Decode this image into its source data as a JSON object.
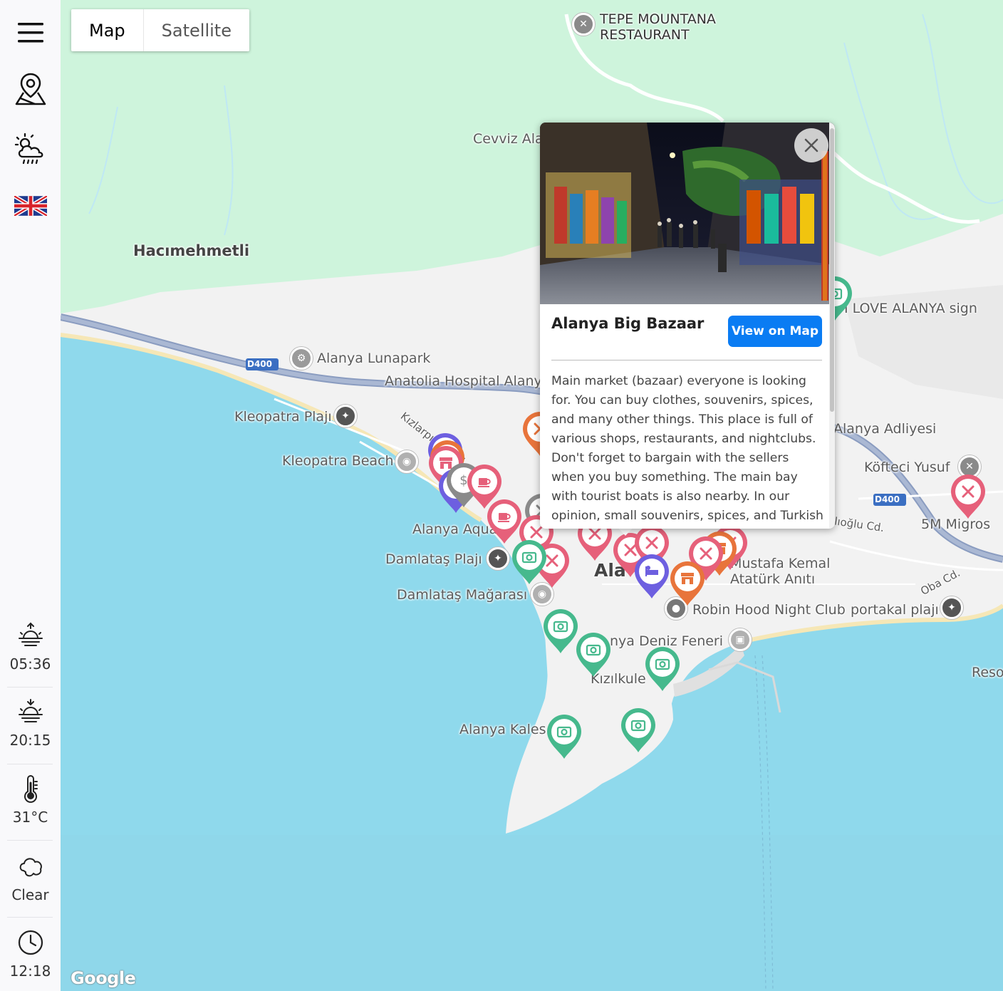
{
  "sidebar": {
    "menu_icon": "hamburger-menu-icon",
    "map_icon": "map-pin-icon",
    "weather_icon": "weather-cloud-sun-rain-icon",
    "language_icon": "uk-flag-icon",
    "sunrise": "05:36",
    "sunset": "20:15",
    "temperature": "31°C",
    "condition": "Clear",
    "time": "12:18"
  },
  "map_type": {
    "map_label": "Map",
    "satellite_label": "Satellite",
    "selected": "Map"
  },
  "map_labels": {
    "tepe_line1": "TEPE MOUNTANA",
    "tepe_line2": "RESTAURANT",
    "cevviz": "Cevviz Ala",
    "hacimehmetli": "Hacımehmetli",
    "lunapark": "Alanya Lunapark",
    "hospital": "Anatolia Hospital Alany",
    "d400_left": "D400",
    "d400_right": "D400",
    "kleopatra_plaji": "Kleopatra Plajı",
    "kleopatra_beach": "Kleopatra Beach",
    "kizlarpinari": "Kızlarpınarı Cd.",
    "aqua": "Alanya Aqua",
    "damlatas_plaji": "Damlataş Plajı",
    "damlatas_magarasi": "Damlataş Mağarası",
    "alanya_center": "Ala",
    "love_sign": "I LOVE ALANYA sign",
    "adliyesi": "Alanya Adliyesi",
    "kofteci": "Köfteci Yusuf",
    "migros": "5M Migros",
    "hoglu": "ılıoğlu Cd.",
    "oba": "Oba Cd.",
    "mustafa_line1": "Mustafa Kemal",
    "mustafa_line2": "Atatürk Anıtı",
    "robin_hood": "Robin Hood Night Club",
    "portakal": "portakal plajı",
    "deniz_feneri": "nya Deniz Feneri",
    "kizilkule": "Kızılkule",
    "kalesi": "Alanya Kales",
    "reso": "Reso",
    "google": "Google"
  },
  "popup": {
    "title": "Alanya Big Bazaar",
    "button_label": "View on Map",
    "description": "Main market (bazaar) everyone is looking for. You can buy clothes, souvenirs, spices, and many other things. This place is full of various shops, restaurants, and nightclubs. Don't forget to bargain with the sellers when you buy something. The main bay with tourist boats is also nearby. In our opinion, small souvenirs, spices, and Turkish"
  },
  "colors": {
    "land": "#f2f2f2",
    "sea": "#8fd9ec",
    "green": "#cef4dc",
    "road": "#9aa9c4",
    "accent_button": "#0a7cf3",
    "pin_green": "#46b98d",
    "pin_pink": "#e6607a",
    "pin_purple": "#6d5fe0",
    "pin_orange": "#e8743b",
    "pin_gray": "#8a8a8a"
  }
}
